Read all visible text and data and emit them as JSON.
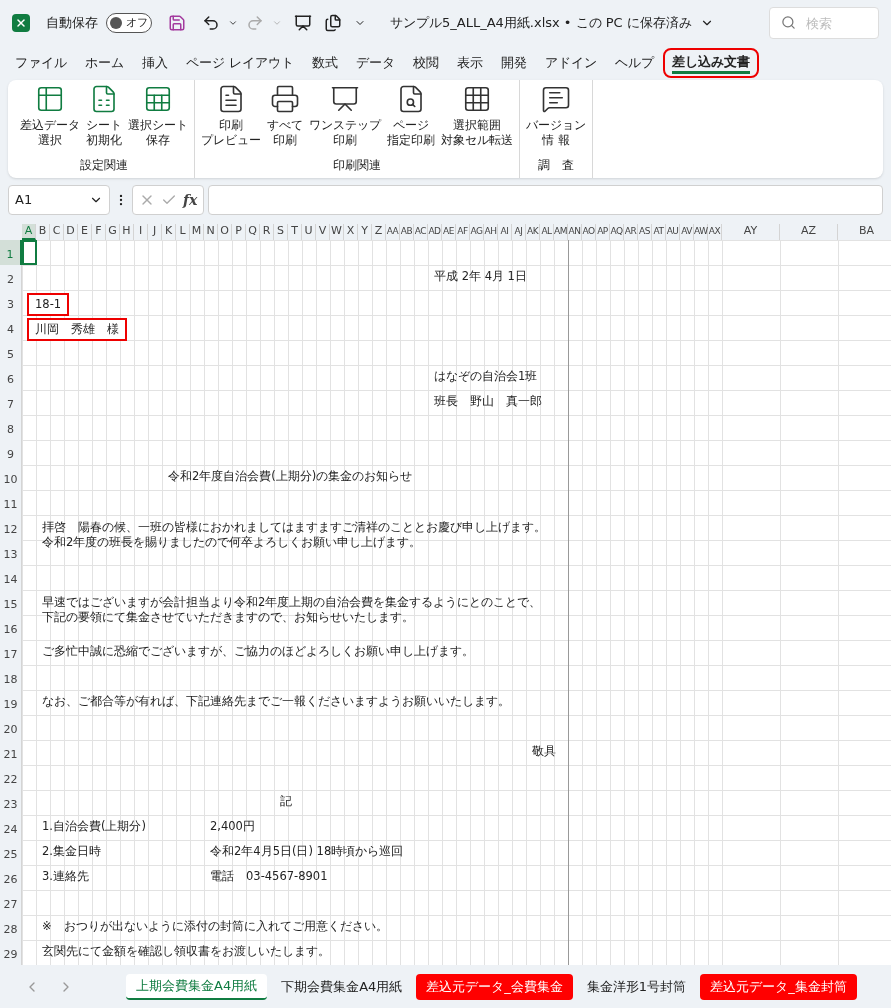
{
  "title_bar": {
    "autosave_label": "自動保存",
    "autosave_toggle": {
      "label": "オフ",
      "on": false
    },
    "file_title": "サンプル5_ALL_A4用紙.xlsx • この PC に保存済み",
    "search": {
      "placeholder": "検索"
    }
  },
  "menu_tabs": [
    {
      "label": "ファイル",
      "selected": false,
      "annotated": false
    },
    {
      "label": "ホーム",
      "selected": false,
      "annotated": false
    },
    {
      "label": "挿入",
      "selected": false,
      "annotated": false
    },
    {
      "label": "ページ レイアウト",
      "selected": false,
      "annotated": false
    },
    {
      "label": "数式",
      "selected": false,
      "annotated": false
    },
    {
      "label": "データ",
      "selected": false,
      "annotated": false
    },
    {
      "label": "校閲",
      "selected": false,
      "annotated": false
    },
    {
      "label": "表示",
      "selected": false,
      "annotated": false
    },
    {
      "label": "開発",
      "selected": false,
      "annotated": false
    },
    {
      "label": "アドイン",
      "selected": false,
      "annotated": false
    },
    {
      "label": "ヘルプ",
      "selected": false,
      "annotated": false
    },
    {
      "label": "差し込み文書",
      "selected": true,
      "annotated": true
    }
  ],
  "ribbon_groups": [
    {
      "label": "設定関連",
      "buttons": [
        {
          "lines": [
            "差込データ",
            "選択"
          ]
        },
        {
          "lines": [
            "シート",
            "初期化"
          ]
        },
        {
          "lines": [
            "選択シート",
            "保存"
          ]
        }
      ]
    },
    {
      "label": "印刷関連",
      "buttons": [
        {
          "lines": [
            "印刷",
            "プレビュー"
          ]
        },
        {
          "lines": [
            "すべて",
            "印刷"
          ]
        },
        {
          "lines": [
            "ワンステップ",
            "印刷"
          ]
        },
        {
          "lines": [
            "ページ",
            "指定印刷"
          ]
        },
        {
          "lines": [
            "選択範囲",
            "対象セル転送"
          ]
        }
      ]
    },
    {
      "label": "調　査",
      "buttons": [
        {
          "lines": [
            "バージョン",
            "情 報"
          ]
        }
      ]
    }
  ],
  "formula_bar": {
    "name_box": "A1",
    "function_label": "fx"
  },
  "sheet": {
    "columns": [
      {
        "label": "A",
        "selected": true
      },
      {
        "label": "B",
        "selected": false
      },
      {
        "label": "C",
        "selected": false
      },
      {
        "label": "D",
        "selected": false
      },
      {
        "label": "E",
        "selected": false
      },
      {
        "label": "F",
        "selected": false
      },
      {
        "label": "G",
        "selected": false
      },
      {
        "label": "H",
        "selected": false
      },
      {
        "label": "I",
        "selected": false
      },
      {
        "label": "J",
        "selected": false
      },
      {
        "label": "K",
        "selected": false
      },
      {
        "label": "L",
        "selected": false
      },
      {
        "label": "M",
        "selected": false
      },
      {
        "label": "N",
        "selected": false
      },
      {
        "label": "O",
        "selected": false
      },
      {
        "label": "P",
        "selected": false
      },
      {
        "label": "Q",
        "selected": false
      },
      {
        "label": "R",
        "selected": false
      },
      {
        "label": "S",
        "selected": false
      },
      {
        "label": "T",
        "selected": false
      },
      {
        "label": "U",
        "selected": false
      },
      {
        "label": "V",
        "selected": false
      },
      {
        "label": "W",
        "selected": false
      },
      {
        "label": "X",
        "selected": false
      },
      {
        "label": "Y",
        "selected": false
      },
      {
        "label": "Z",
        "selected": false
      },
      {
        "label": "AA",
        "selected": false
      },
      {
        "label": "AB",
        "selected": false
      },
      {
        "label": "AC",
        "selected": false
      },
      {
        "label": "AD",
        "selected": false
      },
      {
        "label": "AE",
        "selected": false
      },
      {
        "label": "AF",
        "selected": false
      },
      {
        "label": "AG",
        "selected": false
      },
      {
        "label": "AH",
        "selected": false
      },
      {
        "label": "AI",
        "selected": false
      },
      {
        "label": "AJ",
        "selected": false
      },
      {
        "label": "AK",
        "selected": false
      },
      {
        "label": "AL",
        "selected": false
      },
      {
        "label": "AM",
        "selected": false
      },
      {
        "label": "AN",
        "selected": false
      },
      {
        "label": "AO",
        "selected": false
      },
      {
        "label": "AP",
        "selected": false
      },
      {
        "label": "AQ",
        "selected": false
      },
      {
        "label": "AR",
        "selected": false
      },
      {
        "label": "AS",
        "selected": false
      },
      {
        "label": "AT",
        "selected": false
      },
      {
        "label": "AU",
        "selected": false
      },
      {
        "label": "AV",
        "selected": false
      },
      {
        "label": "AW",
        "selected": false
      },
      {
        "label": "AX",
        "selected": false
      },
      {
        "label": "AY",
        "selected": false
      },
      {
        "label": "AZ",
        "selected": false
      },
      {
        "label": "BA",
        "selected": false
      }
    ],
    "rows": [
      {
        "number": "1",
        "selected": true,
        "cells": []
      },
      {
        "number": "2",
        "selected": false,
        "cells": [
          {
            "kind": "sender",
            "lines": [
              "平成 2年 4月 1日"
            ],
            "annotated": false
          }
        ]
      },
      {
        "number": "3",
        "selected": false,
        "cells": [
          {
            "kind": "body",
            "lines": [
              "18-1"
            ],
            "annotated": true
          }
        ]
      },
      {
        "number": "4",
        "selected": false,
        "cells": [
          {
            "kind": "body",
            "lines": [
              "川岡　秀雄　様"
            ],
            "annotated": true
          }
        ]
      },
      {
        "number": "5",
        "selected": false,
        "cells": []
      },
      {
        "number": "6",
        "selected": false,
        "cells": [
          {
            "kind": "sender",
            "lines": [
              "はなぞの自治会1班"
            ],
            "annotated": false
          }
        ]
      },
      {
        "number": "7",
        "selected": false,
        "cells": [
          {
            "kind": "sender",
            "lines": [
              "班長　野山　真一郎"
            ],
            "annotated": false
          }
        ]
      },
      {
        "number": "8",
        "selected": false,
        "cells": []
      },
      {
        "number": "9",
        "selected": false,
        "cells": []
      },
      {
        "number": "10",
        "selected": false,
        "cells": [
          {
            "kind": "title",
            "lines": [
              "令和2年度自治会費(上期分)の集金のお知らせ"
            ],
            "annotated": false
          }
        ]
      },
      {
        "number": "11",
        "selected": false,
        "cells": []
      },
      {
        "number": "12",
        "selected": false,
        "cells": [
          {
            "kind": "body",
            "lines": [
              "拝啓　陽春の候、一班の皆様におかれましてはますますご清祥のこととお慶び申し上げます。",
              "令和2年度の班長を賜りましたので何卒よろしくお願い申し上げます。"
            ],
            "annotated": false
          }
        ]
      },
      {
        "number": "13",
        "selected": false,
        "cells": []
      },
      {
        "number": "14",
        "selected": false,
        "cells": []
      },
      {
        "number": "15",
        "selected": false,
        "cells": [
          {
            "kind": "body",
            "lines": [
              "早速ではございますが会計担当より令和2年度上期の自治会費を集金するようにとのことで、",
              "下記の要領にて集金させていただきますので、お知らせいたします。"
            ],
            "annotated": false
          }
        ]
      },
      {
        "number": "16",
        "selected": false,
        "cells": []
      },
      {
        "number": "17",
        "selected": false,
        "cells": [
          {
            "kind": "body",
            "lines": [
              "ご多忙中誠に恐縮でございますが、ご協力のほどよろしくお願い申し上げます。"
            ],
            "annotated": false
          }
        ]
      },
      {
        "number": "18",
        "selected": false,
        "cells": []
      },
      {
        "number": "19",
        "selected": false,
        "cells": [
          {
            "kind": "body",
            "lines": [
              "なお、ご都合等が有れば、下記連絡先までご一報くださいますようお願いいたします。"
            ],
            "annotated": false
          }
        ]
      },
      {
        "number": "20",
        "selected": false,
        "cells": []
      },
      {
        "number": "21",
        "selected": false,
        "cells": [
          {
            "kind": "closing",
            "lines": [
              "敬具"
            ],
            "annotated": false
          }
        ]
      },
      {
        "number": "22",
        "selected": false,
        "cells": []
      },
      {
        "number": "23",
        "selected": false,
        "cells": [
          {
            "kind": "heading",
            "lines": [
              "記"
            ],
            "annotated": false
          }
        ]
      },
      {
        "number": "24",
        "selected": false,
        "cells": [
          {
            "kind": "body",
            "lines": [
              "1.自治会費(上期分)"
            ],
            "annotated": false
          },
          {
            "kind": "value",
            "lines": [
              "2,400円"
            ],
            "annotated": false
          }
        ]
      },
      {
        "number": "25",
        "selected": false,
        "cells": [
          {
            "kind": "body",
            "lines": [
              "2.集金日時"
            ],
            "annotated": false
          },
          {
            "kind": "value",
            "lines": [
              "令和2年4月5日(日) 18時頃から巡回"
            ],
            "annotated": false
          }
        ]
      },
      {
        "number": "26",
        "selected": false,
        "cells": [
          {
            "kind": "body",
            "lines": [
              "3.連絡先"
            ],
            "annotated": false
          },
          {
            "kind": "value",
            "lines": [
              "電話　03-4567-8901"
            ],
            "annotated": false
          }
        ]
      },
      {
        "number": "27",
        "selected": false,
        "cells": []
      },
      {
        "number": "28",
        "selected": false,
        "cells": [
          {
            "kind": "body",
            "lines": [
              "※　おつりが出ないように添付の封筒に入れてご用意ください。"
            ],
            "annotated": false
          }
        ]
      },
      {
        "number": "29",
        "selected": false,
        "cells": [
          {
            "kind": "body",
            "lines": [
              "玄関先にて金額を確認し領収書をお渡しいたします。"
            ],
            "annotated": false
          }
        ]
      }
    ]
  },
  "sheet_tabs": [
    {
      "label": "上期会費集金A4用紙",
      "selected": true
    },
    {
      "label": "下期会費集金A4用紙",
      "selected": false
    },
    {
      "label": "差込元データ_会費集金",
      "selected": false,
      "color": "#ff0000"
    },
    {
      "label": "集金洋形1号封筒",
      "selected": false
    },
    {
      "label": "差込元データ_集金封筒",
      "selected": false,
      "color": "#ff0000"
    }
  ]
}
